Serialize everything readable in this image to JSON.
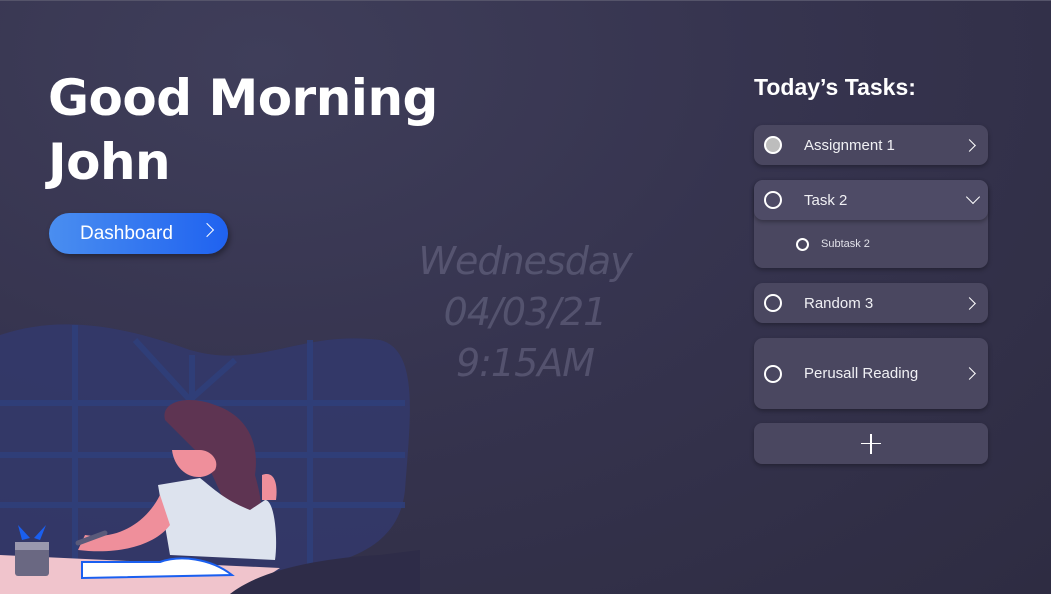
{
  "greeting": {
    "line1": "Good Morning",
    "line2": "John"
  },
  "dashboard_button": {
    "label": "Dashboard"
  },
  "clock": {
    "day": "Wednesday",
    "date": "04/03/21",
    "time": "9:15AM"
  },
  "tasks": {
    "title": "Today’s Tasks:",
    "items": [
      {
        "label": "Assignment 1",
        "completed": true
      },
      {
        "label": "Task 2",
        "completed": false,
        "expanded": true,
        "subtasks": [
          {
            "label": "Subtask 2"
          }
        ]
      },
      {
        "label": "Random 3",
        "completed": false
      },
      {
        "label": "Perusall Reading",
        "completed": false
      }
    ],
    "add_icon": "plus-icon"
  },
  "colors": {
    "accent": "#1f62f0",
    "card": "#4a4760",
    "background": "#36344f"
  }
}
